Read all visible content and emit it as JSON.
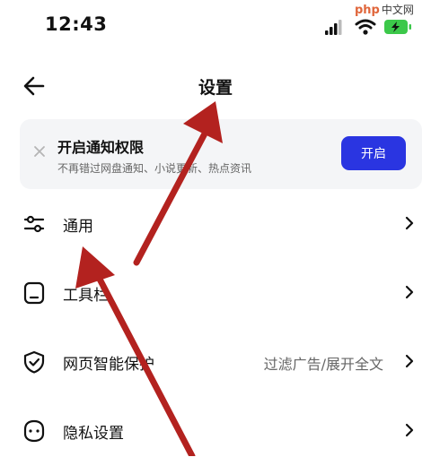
{
  "status_bar": {
    "time": "12:43",
    "icons": [
      "signal-icon",
      "wifi-icon",
      "battery-charging-icon"
    ],
    "battery_color": "#3cc84a"
  },
  "watermark": {
    "part1": "php",
    "part2": "中文网"
  },
  "header": {
    "title": "设置",
    "back_icon": "arrow-left-icon"
  },
  "notice": {
    "title": "开启通知权限",
    "description": "不再错过网盘通知、小说更新、热点资讯",
    "button_label": "开启",
    "close_icon": "close-icon"
  },
  "menu": [
    {
      "label": "通用",
      "value": "",
      "icon": "sliders-icon"
    },
    {
      "label": "工具栏",
      "value": "",
      "icon": "toolbar-icon"
    },
    {
      "label": "网页智能保护",
      "value": "过滤广告/展开全文",
      "icon": "shield-check-icon"
    },
    {
      "label": "隐私设置",
      "value": "",
      "icon": "privacy-mask-icon"
    }
  ],
  "colors": {
    "accent": "#2a35e1",
    "annotation_arrow": "#b3221f",
    "notice_bg": "#f4f5f7"
  }
}
